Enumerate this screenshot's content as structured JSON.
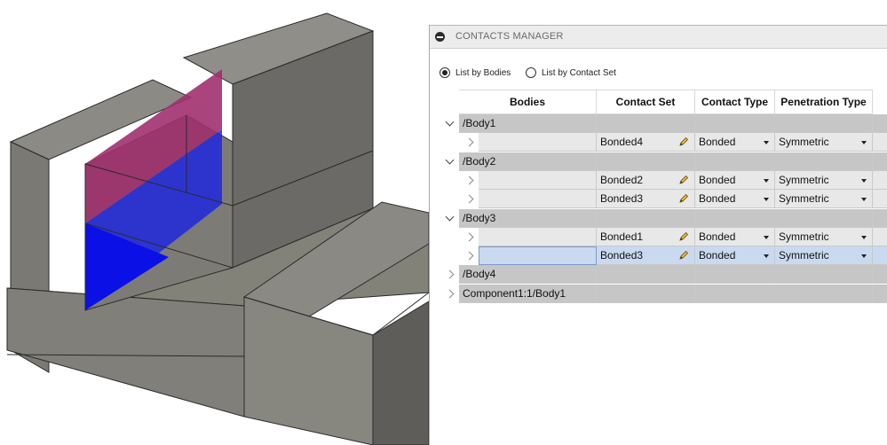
{
  "panel": {
    "title": "CONTACTS MANAGER",
    "radio_options": [
      {
        "label": "List by Bodies",
        "checked": true
      },
      {
        "label": "List by Contact Set",
        "checked": false
      }
    ]
  },
  "table": {
    "columns": [
      "Bodies",
      "Contact Set",
      "Contact Type",
      "Penetration Type"
    ],
    "rows": [
      {
        "kind": "group",
        "expanded": true,
        "body": "/Body1"
      },
      {
        "kind": "child",
        "contact_set": "Bonded4",
        "contact_type": "Bonded",
        "penetration_type": "Symmetric"
      },
      {
        "kind": "group",
        "expanded": true,
        "body": "/Body2"
      },
      {
        "kind": "child",
        "contact_set": "Bonded2",
        "contact_type": "Bonded",
        "penetration_type": "Symmetric"
      },
      {
        "kind": "child",
        "contact_set": "Bonded3",
        "contact_type": "Bonded",
        "penetration_type": "Symmetric"
      },
      {
        "kind": "group",
        "expanded": true,
        "body": "/Body3"
      },
      {
        "kind": "child",
        "contact_set": "Bonded1",
        "contact_type": "Bonded",
        "penetration_type": "Symmetric"
      },
      {
        "kind": "child",
        "contact_set": "Bonded3",
        "contact_type": "Bonded",
        "penetration_type": "Symmetric",
        "selected": true
      },
      {
        "kind": "group",
        "expanded": false,
        "body": "/Body4"
      },
      {
        "kind": "group",
        "expanded": false,
        "body": "Component1:1/Body1"
      }
    ]
  },
  "colors": {
    "model_face_light": "#8e8d87",
    "model_face_mid": "#6f6e6a",
    "model_face_dark": "#5b5a56",
    "contact_magenta": "#a0306e",
    "contact_blue": "#0a10e6",
    "selection": "#c9daf0"
  }
}
